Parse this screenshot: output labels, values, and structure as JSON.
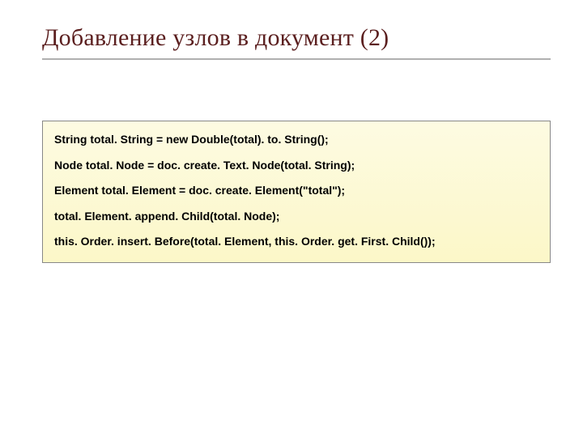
{
  "slide": {
    "title": "Добавление узлов в документ (2)",
    "code_lines": [
      "String total. String = new Double(total). to. String();",
      "Node total. Node = doc. create. Text. Node(total. String);",
      "Element total. Element = doc. create. Element(\"total\");",
      "total. Element. append. Child(total. Node);",
      "this. Order. insert. Before(total. Element, this. Order. get. First. Child());"
    ]
  }
}
